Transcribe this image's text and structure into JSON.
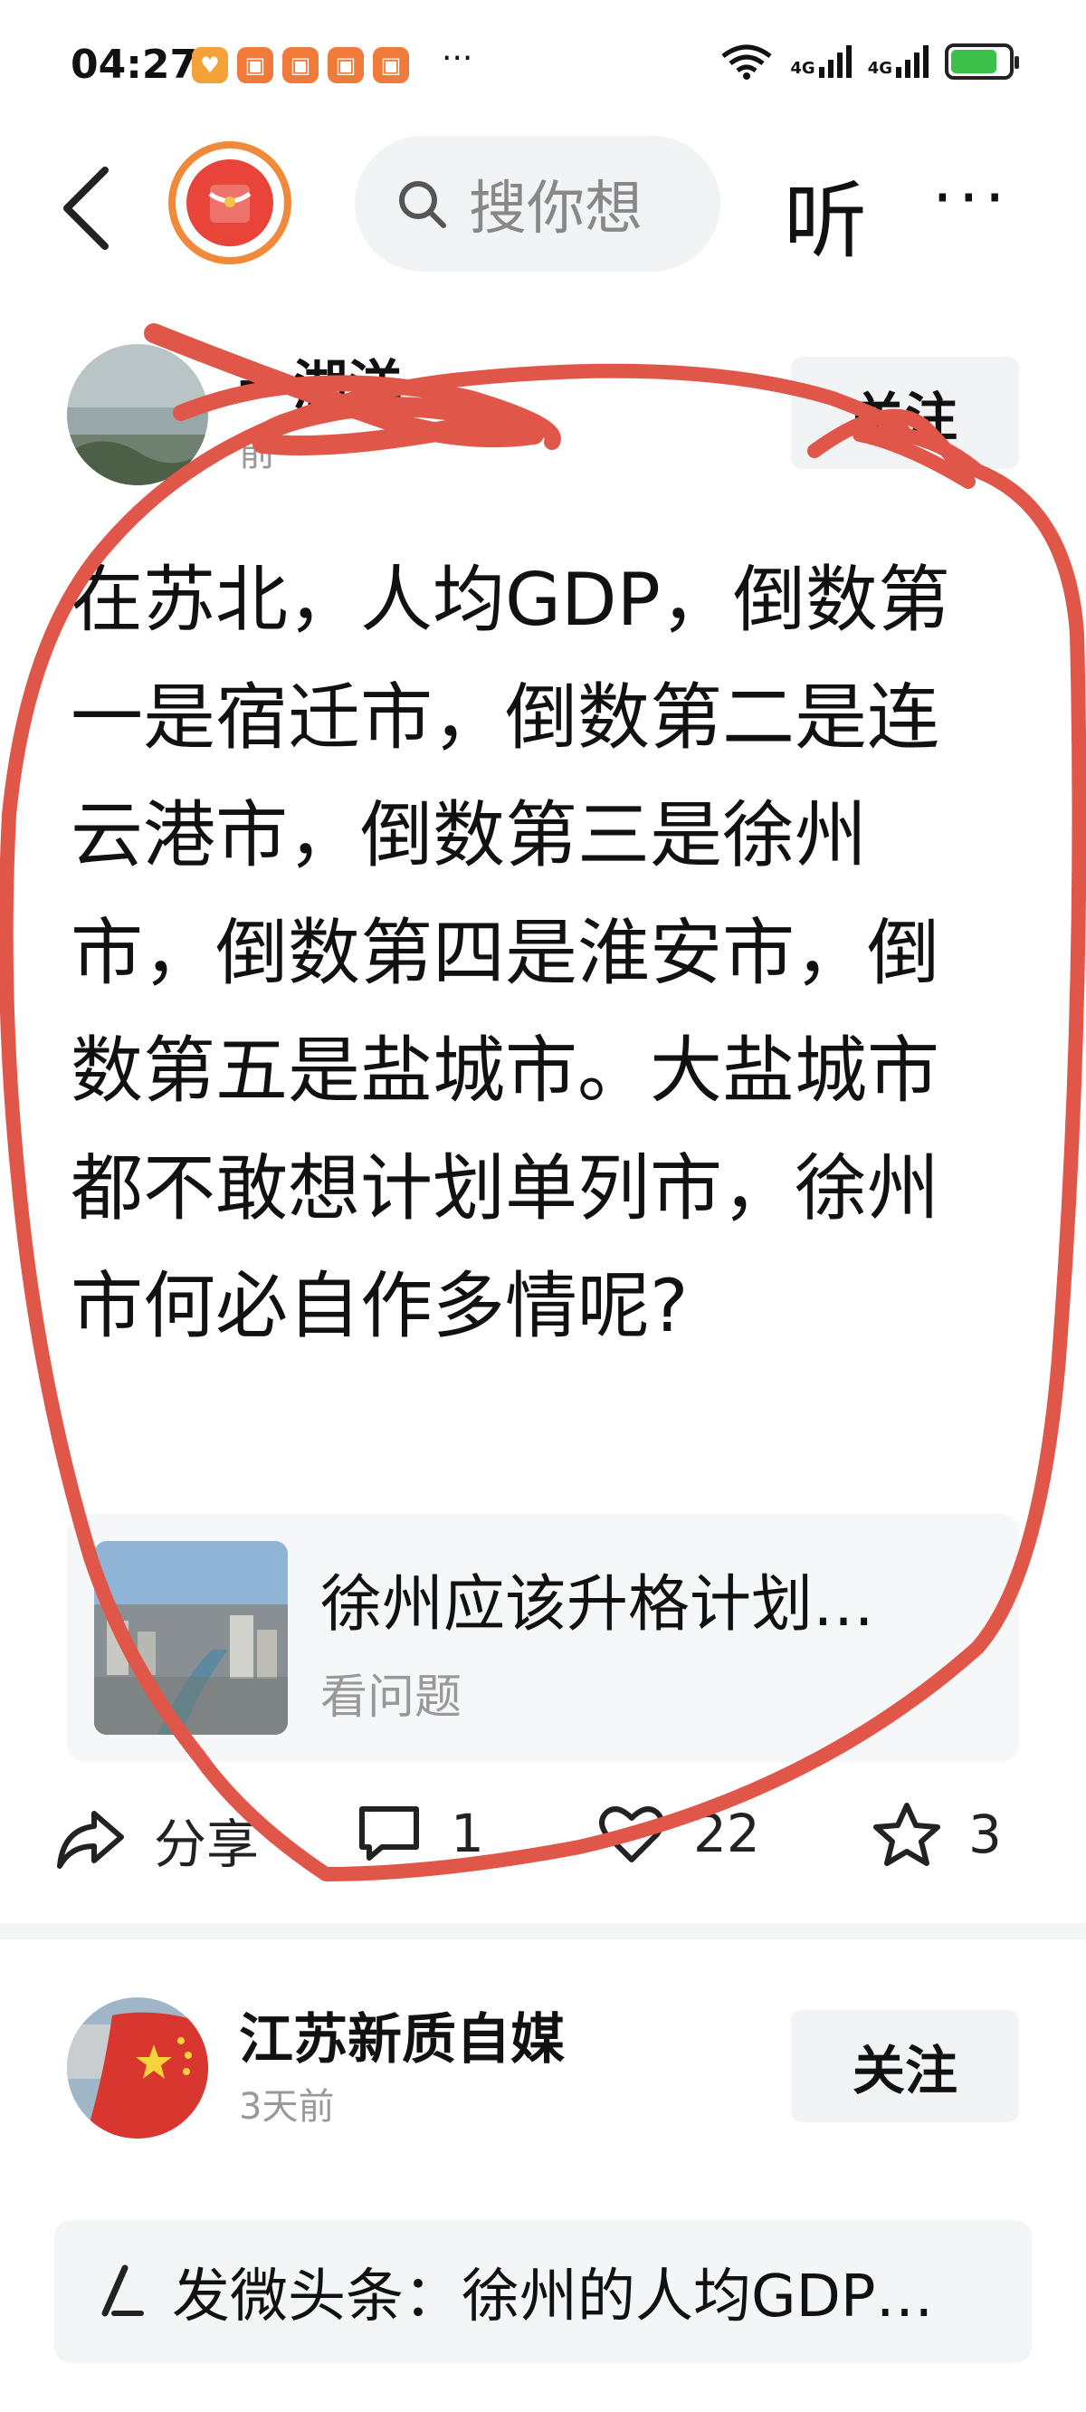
{
  "status_bar": {
    "time": "04:27",
    "more": "···",
    "signal1_label": "4G",
    "signal2_label": "4G",
    "battery_level": 0.8,
    "battery_color": "#3cc04a"
  },
  "nav": {
    "search_placeholder": "搜你想",
    "listen_label": "听",
    "more_label": "···"
  },
  "post1": {
    "author": "一湖洋",
    "time": "前",
    "follow_label": "关注",
    "body": "在苏北，人均GDP，倒数第一是宿迁市，倒数第二是连云港市，倒数第三是徐州市，倒数第四是淮安市，倒数第五是盐城市。大盐城市都不敢想计划单列市，徐州市何必自作多情呢?",
    "question": {
      "title": "徐州应该升格计划…",
      "link_label": "看问题"
    },
    "actions": {
      "share_label": "分享",
      "comment_count": "1",
      "like_count": "22",
      "favorite_count": "3"
    }
  },
  "post2": {
    "author": "江苏新质自媒",
    "time": "3天前",
    "follow_label": "关注",
    "related_text": "发微头条：徐州的人均GDP…"
  },
  "colors": {
    "annotation_red": "#e0574a",
    "logo_ring": "#f08a3a",
    "logo_fill": "#e8443a"
  },
  "icons": {
    "back": "chevron-left-icon",
    "search": "search-icon",
    "share": "share-icon",
    "comment": "comment-icon",
    "like": "heart-icon",
    "favorite": "star-icon",
    "related": "edit-icon"
  }
}
